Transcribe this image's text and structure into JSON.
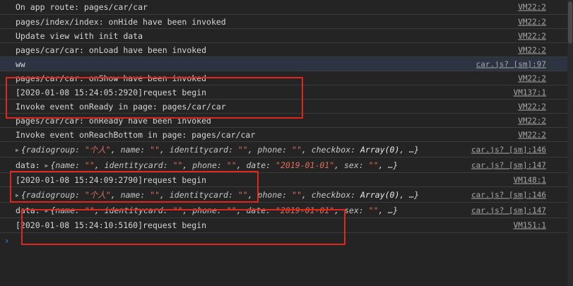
{
  "rows": [
    {
      "text": "On app route: pages/car/car",
      "source": "VM22:2"
    },
    {
      "text": "pages/index/index: onHide have been invoked",
      "source": "VM22:2"
    },
    {
      "text": "Update view with init data",
      "source": "VM22:2"
    },
    {
      "text": "pages/car/car: onLoad have been invoked",
      "source": "VM22:2"
    },
    {
      "text": "ww",
      "source": "car.js? [sm]:97"
    },
    {
      "text": "pages/car/car: onShow have been invoked",
      "source": "VM22:2"
    },
    {
      "text": "[2020-01-08 15:24:05:2920]request begin",
      "source": "VM137:1"
    },
    {
      "text": "Invoke event onReady in page: pages/car/car",
      "source": "VM22:2"
    },
    {
      "text": "pages/car/car: onReady have been invoked",
      "source": "VM22:2"
    },
    {
      "text": "Invoke event onReachBottom in page: pages/car/car",
      "source": "VM22:2"
    },
    {
      "source": "car.js? [sm]:146"
    },
    {
      "prefix": "data:",
      "source": "car.js? [sm]:147"
    },
    {
      "text": "[2020-01-08 15:24:09:2790]request begin",
      "source": "VM148:1"
    },
    {
      "source": "car.js? [sm]:146"
    },
    {
      "prefix": "data:",
      "source": "car.js? [sm]:147"
    },
    {
      "text": "[2020-01-08 15:24:10:5160]request begin",
      "source": "VM151:1"
    }
  ],
  "obj1": {
    "k1": "radiogroup:",
    "v1": "\"个人\"",
    "k2": "name:",
    "v2": "\"\"",
    "k3": "identitycard:",
    "v3": "\"\"",
    "k4": "phone:",
    "v4": "\"\"",
    "k5": "checkbox:",
    "v5": "Array(0)",
    "tail": "…}"
  },
  "obj2": {
    "k1": "name:",
    "v1": "\"\"",
    "k2": "identitycard:",
    "v2": "\"\"",
    "k3": "phone:",
    "v3": "\"\"",
    "k4": "date:",
    "v4": "\"2019-01-01\"",
    "k5": "sex:",
    "v5": "\"\"",
    "tail": "…}"
  },
  "prompt_symbol": "›",
  "colors": {
    "background": "#242424",
    "highlight": "#2c3442",
    "annotation": "#e1261c",
    "string": "#e06c5b",
    "prompt": "#3b8eea"
  }
}
